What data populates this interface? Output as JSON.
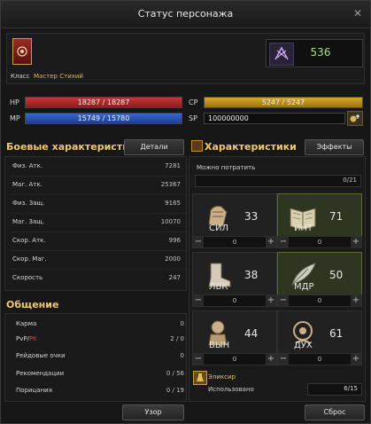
{
  "window": {
    "title": "Статус персонажа",
    "close_icon": "close-icon"
  },
  "character": {
    "class_label": "Класс",
    "class_value": "Мастер Стихий",
    "combat_power": "536"
  },
  "bars": {
    "hp": {
      "label": "HP",
      "text": "18287 / 18287",
      "fraction": 1.0,
      "color": "#b52a2a"
    },
    "mp": {
      "label": "MP",
      "text": "15749 / 15780",
      "fraction": 0.998,
      "color": "#2f57b8"
    },
    "cp": {
      "label": "CP",
      "text": "5247 / 5247",
      "fraction": 1.0,
      "color": "#c79a1f"
    },
    "sp": {
      "label": "SP",
      "text": "100000000"
    }
  },
  "combat": {
    "title": "Боевые характеристики",
    "details_button": "Детали",
    "stats": [
      {
        "name": "Физ. Атк.",
        "value": "7281"
      },
      {
        "name": "Маг. Атк.",
        "value": "25367"
      },
      {
        "name": "Физ. Защ.",
        "value": "9165"
      },
      {
        "name": "Маг. Защ.",
        "value": "10070"
      },
      {
        "name": "Скор. Атк.",
        "value": "996"
      },
      {
        "name": "Скор. Маг.",
        "value": "2000"
      },
      {
        "name": "Скорость",
        "value": "247"
      }
    ]
  },
  "social": {
    "title": "Общение",
    "rows": [
      {
        "name": "Карма",
        "value": "0"
      },
      {
        "name_pvp": "PvP",
        "name_sep": "/",
        "name_pk": "PK",
        "value": "2 / 0"
      },
      {
        "name": "Рейдовые очки",
        "value": "0"
      },
      {
        "name": "Рекомендации",
        "value": "0 / 56"
      },
      {
        "name": "Порицания",
        "value": "0 / 19"
      }
    ]
  },
  "attributes": {
    "title": "Характеристики",
    "effects_button": "Эффекты",
    "can_spend_label": "Можно потратить",
    "can_spend_value": "0/21",
    "can_spend_fraction": 0,
    "items": [
      {
        "name": "СИЛ",
        "value": "33",
        "spin": "0"
      },
      {
        "name": "ИНТ",
        "value": "71",
        "spin": "0"
      },
      {
        "name": "ЛВК",
        "value": "38",
        "spin": "0"
      },
      {
        "name": "МДР",
        "value": "50",
        "spin": "0"
      },
      {
        "name": "ВЫН",
        "value": "44",
        "spin": "0"
      },
      {
        "name": "ДУХ",
        "value": "61",
        "spin": "0"
      }
    ],
    "elixir": {
      "title": "Эликсир",
      "used_label": "Использовано",
      "used_value": "6/15"
    }
  },
  "footer": {
    "pattern_button": "Узор",
    "reset_button": "Сброс"
  },
  "colors": {
    "accent_gold": "#f0c870",
    "green_value": "#a8e07a",
    "pk_red": "#e04040"
  }
}
